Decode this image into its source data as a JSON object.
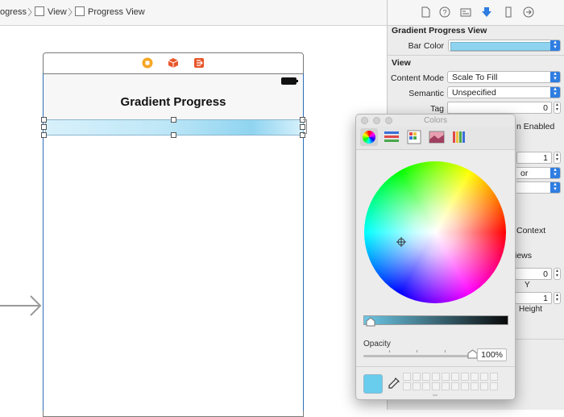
{
  "breadcrumb": {
    "items": [
      {
        "label": "ogress"
      },
      {
        "label": "View"
      },
      {
        "label": "Progress View"
      }
    ]
  },
  "scene": {
    "dock_icons": [
      "view-controller-icon",
      "first-responder-icon",
      "exit-icon"
    ],
    "nav_title": "Gradient Progress"
  },
  "inspector": {
    "tab_icons": [
      "file-icon",
      "help-icon",
      "identity-icon",
      "attributes-icon",
      "size-icon",
      "connections-icon"
    ],
    "gradient_section": {
      "title": "Gradient Progress View",
      "bar_color_label": "Bar Color",
      "bar_color_value": "#8ed3ef"
    },
    "view_section": {
      "title": "View",
      "content_mode_label": "Content Mode",
      "content_mode_value": "Scale To Fill",
      "semantic_label": "Semantic",
      "semantic_value": "Unspecified",
      "tag_label": "Tag",
      "tag_value": "0",
      "interaction_partial": "n Enabled",
      "field_a_value": "1",
      "popup_partial": "or",
      "context_partial": "Context",
      "views_partial": "iews",
      "y_value": "0",
      "y_label": "Y",
      "height_value": "1",
      "height_label": "Height"
    }
  },
  "colors_panel": {
    "title": "Colors",
    "modes": [
      "color-wheel-mode",
      "sliders-mode",
      "palettes-mode",
      "image-palettes-mode",
      "crayons-mode"
    ],
    "opacity_label": "Opacity",
    "opacity_value": "100%",
    "opacity_fraction": 1.0,
    "current_color": "#69cdee"
  }
}
